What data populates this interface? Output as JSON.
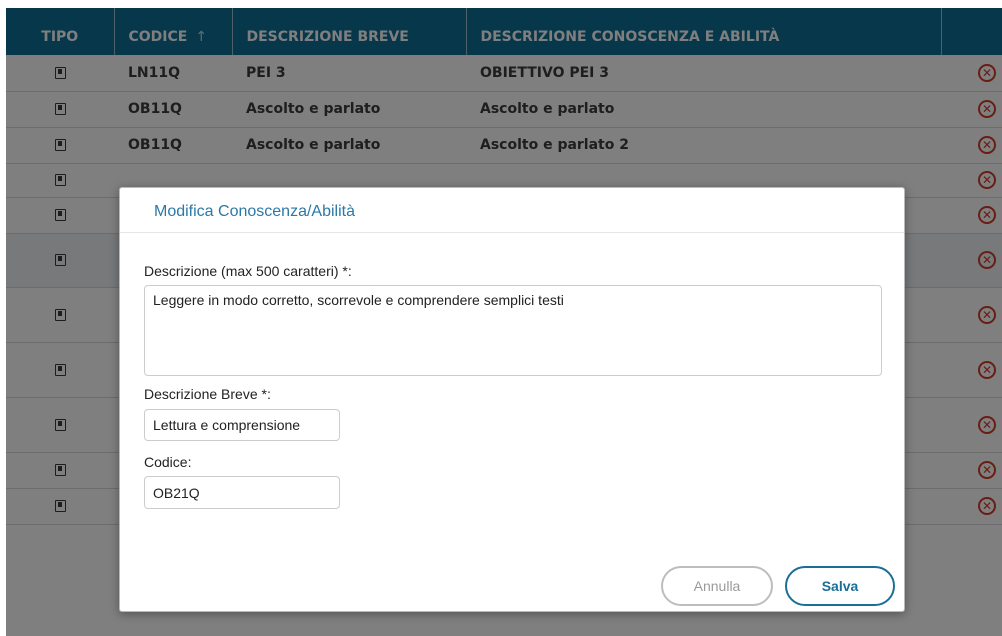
{
  "table": {
    "headers": {
      "tipo": "TIPO",
      "codice": "CODICE",
      "codice_sort": "↑",
      "descrizione_breve": "DESCRIZIONE BREVE",
      "descrizione": "DESCRIZIONE CONOSCENZA E ABILITÀ"
    },
    "rows": [
      {
        "codice": "LN11Q",
        "breve": "PEI 3",
        "descrizione": "OBIETTIVO PEI 3"
      },
      {
        "codice": "OB11Q",
        "breve": "Ascolto e parlato",
        "descrizione": "Ascolto e parlato"
      },
      {
        "codice": "OB11Q",
        "breve": "Ascolto e parlato",
        "descrizione": "Ascolto e parlato 2"
      },
      {
        "codice": "",
        "breve": "",
        "descrizione": ""
      },
      {
        "codice": "",
        "breve": "",
        "descrizione": ""
      },
      {
        "codice": "",
        "breve": "",
        "descrizione": ""
      },
      {
        "codice": "",
        "breve": "",
        "descrizione": ""
      },
      {
        "codice": "",
        "breve": "",
        "descrizione": ""
      },
      {
        "codice": "",
        "breve": "",
        "descrizione": ""
      },
      {
        "codice": "",
        "breve": "",
        "descrizione": ""
      },
      {
        "codice": "",
        "breve": "",
        "descrizione": ""
      }
    ],
    "icons": {
      "tipo": "bookmark-doc-icon",
      "delete": "delete-circle-icon"
    },
    "delete_glyph": "✕"
  },
  "modal": {
    "title": "Modifica Conoscenza/Abilità",
    "descrizione_label": "Descrizione (max 500 caratteri) *:",
    "descrizione_value": "Leggere in modo corretto, scorrevole e comprendere semplici testi",
    "breve_label": "Descrizione Breve *:",
    "breve_value": "Lettura e comprensione",
    "codice_label": "Codice:",
    "codice_value": "OB21Q",
    "cancel_label": "Annulla",
    "save_label": "Salva"
  },
  "colors": {
    "header_bg": "#0f6f97",
    "accent": "#2b79a6",
    "delete": "#d23c28",
    "overlay": "rgba(0,0,0,0.5)"
  }
}
